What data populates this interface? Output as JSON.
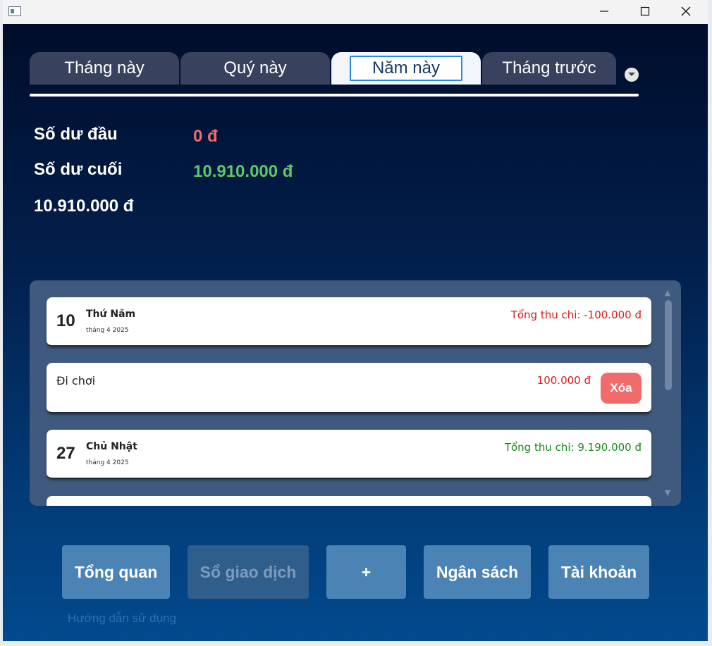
{
  "window": {
    "controls": {
      "minimize_icon": "minimize-icon",
      "maximize_icon": "maximize-icon",
      "close_icon": "close-icon"
    }
  },
  "tabs": {
    "items": [
      {
        "label": "Tháng này",
        "active": false
      },
      {
        "label": "Quý này",
        "active": false
      },
      {
        "label": "Năm này",
        "active": true
      },
      {
        "label": "Tháng trước",
        "active": false
      }
    ],
    "dropdown_icon": "chevron-down-icon"
  },
  "balance": {
    "opening_label": "Số dư đầu",
    "opening_value": "0 đ",
    "closing_label": "Số dư cuối",
    "closing_value": "10.910.000 đ",
    "total_value": "10.910.000 đ"
  },
  "transactions": {
    "groups": [
      {
        "day": "10",
        "weekday": "Thứ Năm",
        "month": "tháng 4 2025",
        "total": "Tổng thu chi: -100.000 đ"
      },
      {
        "day": "27",
        "weekday": "Chủ Nhật",
        "month": "tháng 4 2025",
        "total": "Tổng thu chi: 9.190.000 đ"
      }
    ],
    "items": [
      {
        "name": "Đi chơi",
        "amount": "100.000 đ",
        "delete_label": "Xóa"
      }
    ]
  },
  "nav": {
    "overview": "Tổng quan",
    "ledger": "Sổ giao dịch",
    "add": "+",
    "budget": "Ngân sách",
    "account": "Tài khoản"
  },
  "background": {
    "peek_text": "Hướng dẫn sử dụng"
  },
  "colors": {
    "negative": "#f26b6b",
    "positive": "#5cc96b",
    "expense_total": "#d71a1a",
    "income_total": "#1a8a1a"
  }
}
